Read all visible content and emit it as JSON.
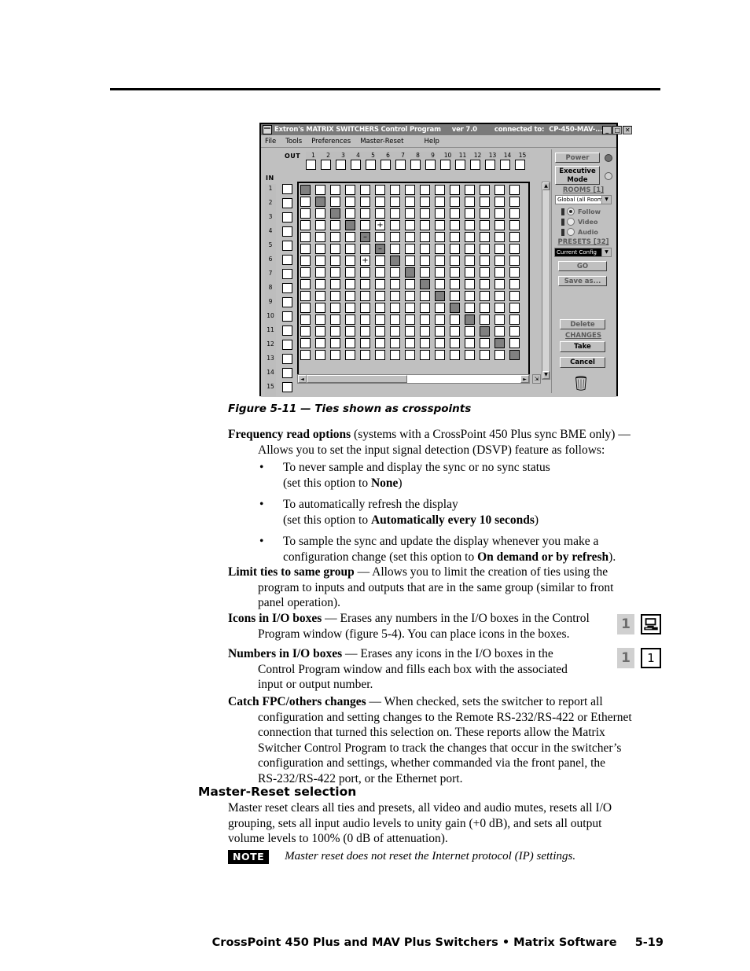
{
  "page": {
    "footer_title": "CrossPoint 450 Plus and MAV Plus Switchers • Matrix Software",
    "page_number": "5-19"
  },
  "app": {
    "title": "Extron's MATRIX SWITCHERS Control Program",
    "version": "ver 7.0",
    "connected_label": "connected to:",
    "connected_value": "CP-450-MAV-...",
    "window_buttons": [
      "_",
      "□",
      "✕"
    ],
    "menu": [
      "File",
      "Tools",
      "Preferences",
      "Master-Reset",
      "Help"
    ],
    "matrix": {
      "out_label": "OUT",
      "in_label": "IN",
      "columns": [
        "1",
        "2",
        "3",
        "4",
        "5",
        "6",
        "7",
        "8",
        "9",
        "10",
        "11",
        "12",
        "13",
        "14",
        "15"
      ],
      "rows": [
        "1",
        "2",
        "3",
        "4",
        "5",
        "6",
        "7",
        "8",
        "9",
        "10",
        "11",
        "12",
        "13",
        "14",
        "15"
      ],
      "ties": [
        {
          "in": 1,
          "out": 1
        },
        {
          "in": 2,
          "out": 2
        },
        {
          "in": 3,
          "out": 3
        },
        {
          "in": 4,
          "out": 4
        },
        {
          "in": 5,
          "out": 5
        },
        {
          "in": 6,
          "out": 6
        },
        {
          "in": 7,
          "out": 7
        },
        {
          "in": 8,
          "out": 8
        },
        {
          "in": 9,
          "out": 9
        },
        {
          "in": 10,
          "out": 10
        },
        {
          "in": 11,
          "out": 11
        },
        {
          "in": 12,
          "out": 12
        },
        {
          "in": 13,
          "out": 13
        },
        {
          "in": 14,
          "out": 14
        },
        {
          "in": 15,
          "out": 15
        }
      ],
      "markers": [
        {
          "in": 4,
          "out": 6,
          "symbol": "+",
          "shaded": false
        },
        {
          "in": 5,
          "out": 5,
          "symbol": "–",
          "shaded": true
        },
        {
          "in": 6,
          "out": 6,
          "symbol": "–",
          "shaded": true
        },
        {
          "in": 7,
          "out": 5,
          "symbol": "+",
          "shaded": false
        }
      ]
    },
    "controls": {
      "power": "Power",
      "executive_mode": "Executive Mode",
      "rooms_label": "ROOMS [1]",
      "rooms_value": "Global (all Room",
      "radios": [
        {
          "label": "Follow",
          "selected": true
        },
        {
          "label": "Video",
          "selected": false
        },
        {
          "label": "Audio",
          "selected": false
        }
      ],
      "presets_label": "PRESETS [32]",
      "presets_value": "Current Config",
      "go": "GO",
      "save_as": "Save as...",
      "delete": "Delete",
      "changes_label": "CHANGES",
      "take": "Take",
      "cancel": "Cancel"
    }
  },
  "figure": {
    "caption": "Figure 5-11 — Ties shown as crosspoints"
  },
  "content": {
    "freq": {
      "lead": "Frequency read options",
      "rest": " (systems with a CrossPoint 450 Plus sync BME only) —",
      "indent": "Allows you to set the input signal detection (DSVP) feature as follows:"
    },
    "bullets": [
      {
        "line1": "To never sample and display the sync or no sync status",
        "line2_pre": "(set this option to ",
        "line2_bold": "None",
        "line2_post": ")"
      },
      {
        "line1": "To automatically refresh the display",
        "line2_pre": "(set this option to ",
        "line2_bold": "Automatically every 10 seconds",
        "line2_post": ")"
      },
      {
        "line1": "To sample the sync and update the display whenever you make a",
        "line2_pre": "configuration change (set this option to ",
        "line2_bold": "On demand or by refresh",
        "line2_post": ")."
      }
    ],
    "limit_ties": {
      "lead": "Limit ties to same group",
      "rest": " — Allows you to limit the creation of ties using the",
      "line2": "program to inputs and outputs that are in the same group (similar to front",
      "line3": "panel operation)."
    },
    "icons_io": {
      "lead": "Icons in I/O boxes",
      "rest": " — Erases any numbers in the I/O boxes in the Control",
      "line2": "Program window (figure 5-4).  You can place icons in the boxes."
    },
    "numbers_io": {
      "lead": "Numbers in I/O boxes",
      "rest": " — Erases any icons in the I/O boxes in the",
      "line2": "Control Program window and fills each box with the associated",
      "line3": "input or output number."
    },
    "catch_fpc": {
      "lead": "Catch FPC/others changes",
      "rest": " — When checked, sets the switcher to report all",
      "line2": "configuration and setting changes to the Remote RS-232/RS-422 or Ethernet",
      "line3": "connection that turned this selection on.  These reports allow the Matrix",
      "line4": "Switcher Control Program to track the changes that occur in the switcher’s",
      "line5": "configuration and settings, whether commanded via the front panel, the",
      "line6": "RS-232/RS-422 port, or the Ethernet port."
    },
    "master_reset": {
      "heading": "Master-Reset selection",
      "line1": "Master reset clears all ties and presets, all video and audio mutes, resets all I/O",
      "line2": "grouping, sets all input audio levels to unity gain (+0 dB), and sets all output",
      "line3": "volume levels to 100% (0 dB of attenuation)."
    },
    "note": {
      "tag": "NOTE",
      "text": "Master reset does not reset the Internet protocol (IP) settings."
    },
    "callouts": [
      {
        "number": "1",
        "icon": "computer-monitor-icon"
      },
      {
        "number": "1",
        "icon": "boxed-number-icon",
        "box_text": "1"
      }
    ]
  }
}
